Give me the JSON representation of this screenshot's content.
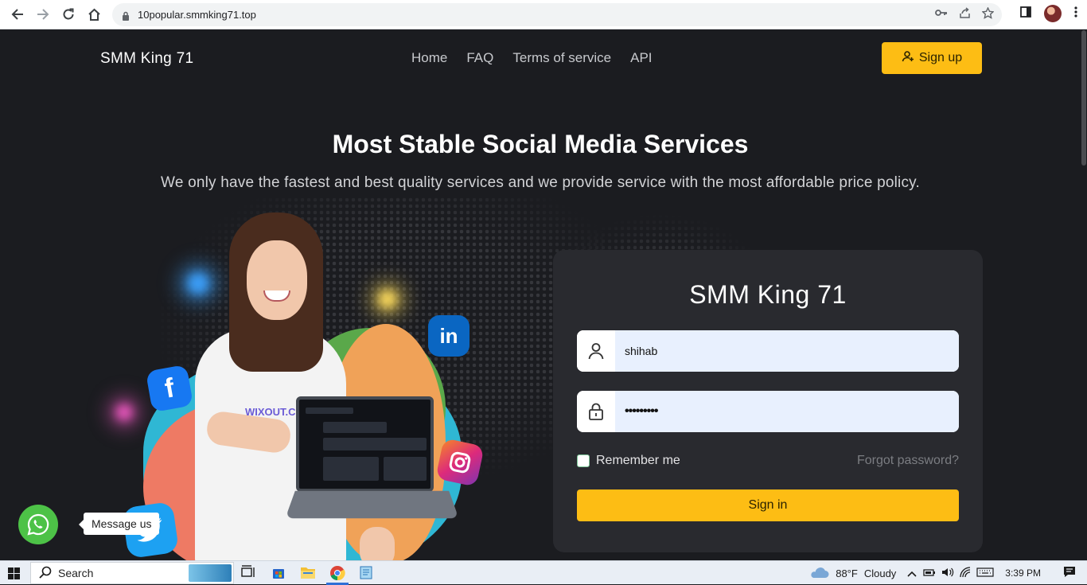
{
  "browser": {
    "url": "10popular.smmking71.top"
  },
  "header": {
    "brand": "SMM King 71",
    "nav": [
      "Home",
      "FAQ",
      "Terms of service",
      "API"
    ],
    "signup_label": "Sign up"
  },
  "hero": {
    "title": "Most Stable Social Media Services",
    "subtitle": "We only have the fastest and best quality services and we provide service with the most affordable price policy."
  },
  "illustration": {
    "shirt_logo": "WIXOUT.COM",
    "social_icons": [
      "facebook-icon",
      "linkedin-icon",
      "instagram-icon",
      "twitter-icon"
    ]
  },
  "login": {
    "title": "SMM King 71",
    "username_value": "shihab",
    "password_value": "•••••••••",
    "remember_label": "Remember me",
    "remember_checked": false,
    "forgot_label": "Forgot password?",
    "signin_label": "Sign in"
  },
  "chat_widget": {
    "label": "Message us"
  },
  "taskbar": {
    "search_label": "Search",
    "weather_temp": "88°F",
    "weather_text": "Cloudy",
    "time": "3:39 PM"
  },
  "colors": {
    "accent": "#fdbd14",
    "page_bg": "#1b1c20",
    "card_bg": "#292a2f",
    "whatsapp": "#4dc247"
  }
}
